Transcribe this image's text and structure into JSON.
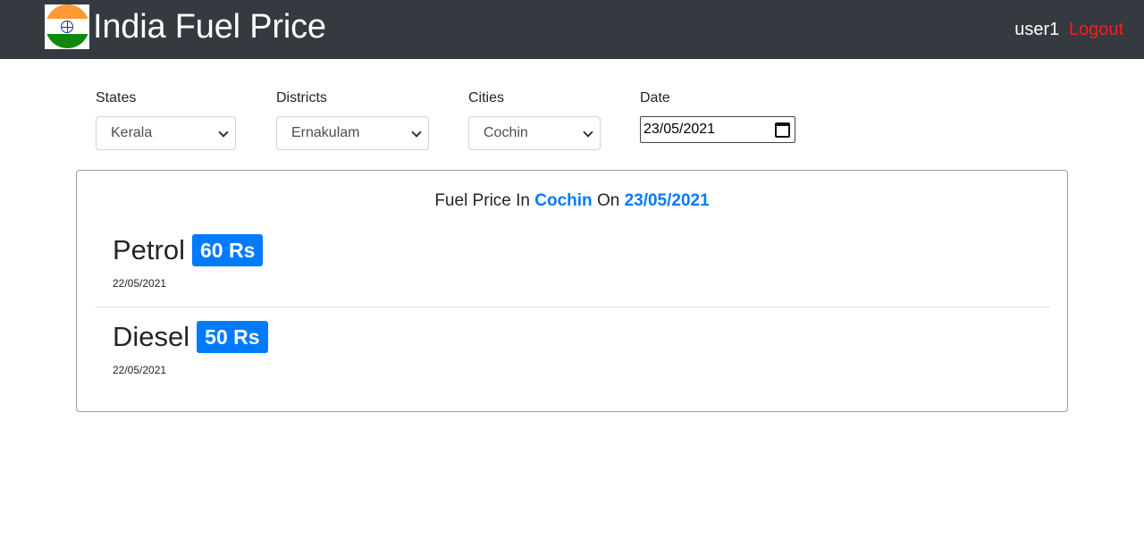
{
  "header": {
    "title": "India Fuel Price",
    "flag_icon": "india-flag-icon",
    "flag_colors": [
      "#ff9933",
      "#ffffff",
      "#138808",
      "#0b3a8f"
    ],
    "username": "user1",
    "logout_label": "Logout"
  },
  "filters": {
    "states": {
      "label": "States",
      "value": "Kerala"
    },
    "districts": {
      "label": "Districts",
      "value": "Ernakulam"
    },
    "cities": {
      "label": "Cities",
      "value": "Cochin"
    },
    "date": {
      "label": "Date",
      "value": "23/05/2021"
    }
  },
  "result": {
    "prefix": "Fuel Price In",
    "city": "Cochin",
    "connector": "On",
    "date": "23/05/2021",
    "accent_color": "#007bff",
    "items": [
      {
        "name": "Petrol",
        "price": "60 Rs",
        "updated": "22/05/2021"
      },
      {
        "name": "Diesel",
        "price": "50 Rs",
        "updated": "22/05/2021"
      }
    ]
  }
}
